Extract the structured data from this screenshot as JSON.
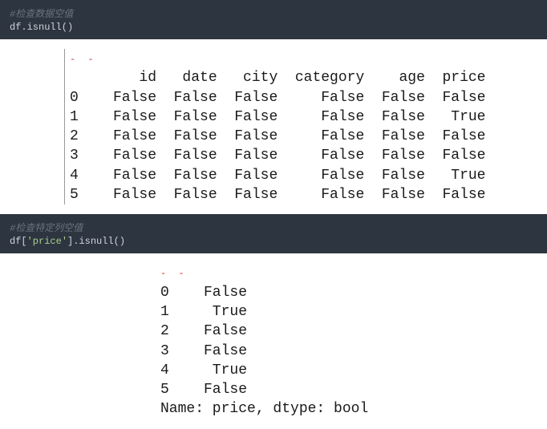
{
  "block1": {
    "comment": "#检查数据空值",
    "code": "df.isnull()",
    "table": {
      "columns": [
        "id",
        "date",
        "city",
        "category",
        "age",
        "price"
      ],
      "rows": [
        {
          "idx": "0",
          "vals": [
            "False",
            "False",
            "False",
            "False",
            "False",
            "False"
          ]
        },
        {
          "idx": "1",
          "vals": [
            "False",
            "False",
            "False",
            "False",
            "False",
            "True"
          ]
        },
        {
          "idx": "2",
          "vals": [
            "False",
            "False",
            "False",
            "False",
            "False",
            "False"
          ]
        },
        {
          "idx": "3",
          "vals": [
            "False",
            "False",
            "False",
            "False",
            "False",
            "False"
          ]
        },
        {
          "idx": "4",
          "vals": [
            "False",
            "False",
            "False",
            "False",
            "False",
            "True"
          ]
        },
        {
          "idx": "5",
          "vals": [
            "False",
            "False",
            "False",
            "False",
            "False",
            "False"
          ]
        }
      ]
    }
  },
  "block2": {
    "comment": "#检查特定列空值",
    "code_pre": "df[",
    "code_str": "'price'",
    "code_post": "].isnull()",
    "series": [
      {
        "idx": "0",
        "val": "False"
      },
      {
        "idx": "1",
        "val": "True"
      },
      {
        "idx": "2",
        "val": "False"
      },
      {
        "idx": "3",
        "val": "False"
      },
      {
        "idx": "4",
        "val": "True"
      },
      {
        "idx": "5",
        "val": "False"
      }
    ],
    "footer": "Name: price, dtype: bool"
  }
}
